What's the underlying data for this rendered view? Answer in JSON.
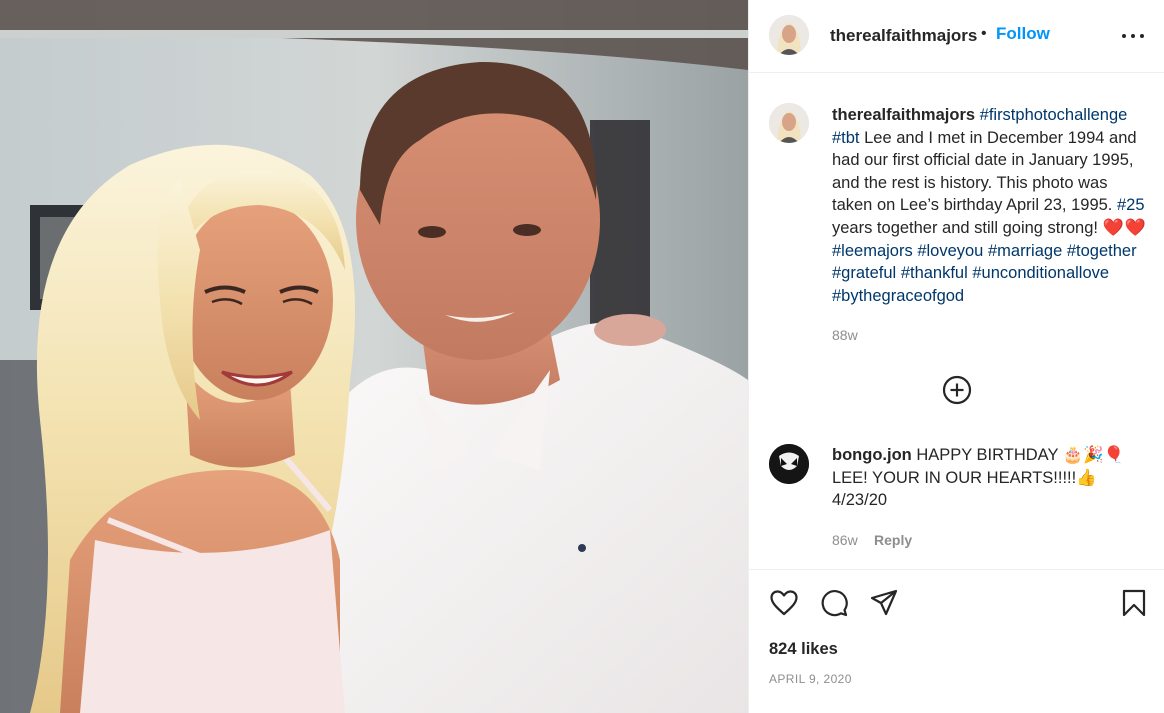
{
  "post": {
    "username": "therealfaithmajors",
    "follow_label": "Follow",
    "caption": {
      "username": "therealfaithmajors",
      "segments": {
        "t1": "#firstphotochallenge",
        "t2": "#tbt",
        "p1": " Lee and I met in December 1994 and had our first official date in January 1995, and the rest is history. This photo was taken on Lee’s birthday April 23, 1995. ",
        "t3": "#25",
        "p2": " years together and still going strong! ",
        "hearts": "❤️❤️",
        "t4": "#leemajors",
        "t5": "#loveyou",
        "t6": "#marriage",
        "t7": "#together",
        "t8": "#grateful",
        "t9": "#thankful",
        "t10": "#unconditionallove",
        "t11": "#bythegraceofgod"
      },
      "time": "88w"
    },
    "comment": {
      "username": "bongo.jon",
      "text": "HAPPY BIRTHDAY 🎂🎉🎈 LEE! YOUR IN OUR HEARTS!!!!!👍 4/23/20",
      "time": "86w",
      "reply_label": "Reply"
    },
    "likes": "824 likes",
    "date": "APRIL 9, 2020"
  },
  "icons": {
    "more": "more-options-icon",
    "load_more": "load-more-comments-icon",
    "like": "heart-icon",
    "comment": "comment-icon",
    "share": "share-icon",
    "save": "bookmark-icon"
  },
  "colors": {
    "link": "#0095f6",
    "hashtag": "#00376b",
    "muted": "#8e8e8e",
    "text": "#262626"
  }
}
